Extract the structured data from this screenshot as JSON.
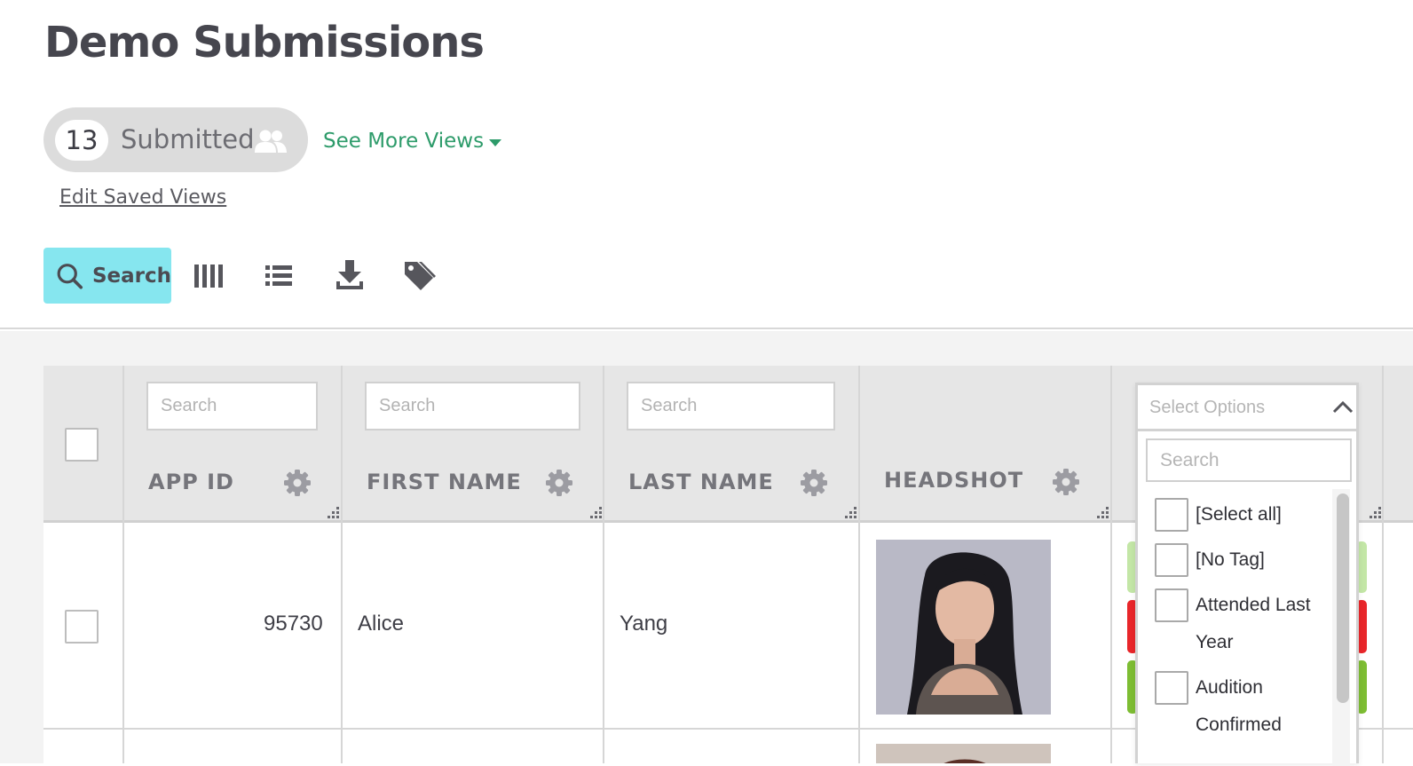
{
  "page": {
    "title": "Demo Submissions"
  },
  "views": {
    "count": "13",
    "current": "Submitted",
    "see_more": "See More Views",
    "edit_saved": "Edit Saved Views"
  },
  "toolbar": {
    "search_label": "Search",
    "icons": [
      "search-icon",
      "columns-icon",
      "list-icon",
      "download-icon",
      "tag-icon"
    ]
  },
  "grid": {
    "filters": {
      "app_id": "Search",
      "first_name": "Search",
      "last_name": "Search"
    },
    "columns": [
      "APP ID",
      "FIRST NAME",
      "LAST NAME",
      "HEADSHOT"
    ],
    "rows": [
      {
        "app_id": "95730",
        "first_name": "Alice",
        "last_name": "Yang"
      }
    ],
    "tag_colors": [
      "#c3e6a6",
      "#e8262a",
      "#7dbd33"
    ]
  },
  "tag_filter": {
    "placeholder": "Select Options",
    "search_placeholder": "Search",
    "options": [
      "[Select all]",
      "[No Tag]",
      "Attended Last Year",
      "Audition Confirmed"
    ]
  }
}
